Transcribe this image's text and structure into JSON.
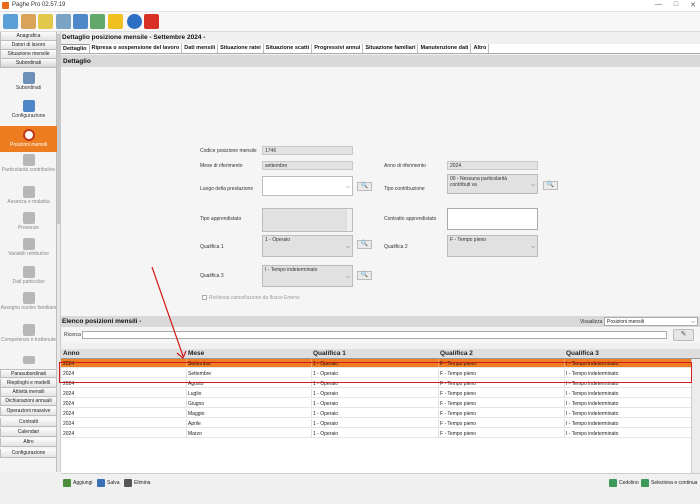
{
  "app": {
    "title": "Paghe Pro 02.57.19"
  },
  "colors": {
    "accent": "#ed7d20",
    "annotation": "#d11c1c"
  },
  "toolbar": {
    "icons": [
      "home-icon",
      "people-icon",
      "coins-icon",
      "gears-icon",
      "computer-icon",
      "lightning-icon",
      "info-icon",
      "close-icon"
    ]
  },
  "sidebar": {
    "top_buttons": [
      "Anagrafica",
      "Datori di lavoro",
      "Situazione mensile",
      "Subordinati"
    ],
    "items": [
      "Subordinati",
      "Configurazione",
      "Posizioni mensili",
      "Particolarità contributive",
      "Assenza e malattia",
      "Presenze",
      "Variabili retributive",
      "Dati particolari",
      "Assegno nucleo familiare",
      "Competenze e trattenute"
    ],
    "bottom_buttons": [
      "Parasubordinati",
      "Riepiloghi e modelli",
      "Attività mensili",
      "Dichiarazioni annuali",
      "Operazioni massive",
      "Contratti",
      "Calendari",
      "Altro",
      "Configurazione"
    ]
  },
  "detail": {
    "title": "Dettaglio posizione mensile - Settembre 2024 -",
    "tabs": [
      "Dettaglio",
      "Ripresa o sospensione del lavoro",
      "Dati mensili",
      "Situazione ratei",
      "Situazione scatti",
      "Progressivi annui",
      "Situazione familiari",
      "Manutenzione dati",
      "Altro"
    ],
    "section": "Dettaglio",
    "fields": {
      "codice_label": "Codice posizione mensile",
      "codice_value": "1746",
      "mese_label": "Mese di riferimento",
      "mese_value": "settembre",
      "anno_label": "Anno di riferimento",
      "anno_value": "2024",
      "luogo_label": "Luogo della prestazione",
      "luogo_value": "",
      "tipo_contr_label": "Tipo contribuzione",
      "tipo_contr_value": "00 - Nessuna particolarità contributi va",
      "tipo_appr_label": "Tipo apprendistato",
      "tipo_appr_value": "",
      "contratto_appr_label": "Contratto apprendistato",
      "contratto_appr_value": "",
      "qual1_label": "Qualifica 1",
      "qual1_value": "1 - Operaio",
      "qual2_label": "Qualifica 2",
      "qual2_value": "F - Tempo pieno",
      "qual3_label": "Qualifica 3",
      "qual3_value": "I - Tempo indeterminato",
      "flusso_label": "Richiesta cancellazione da flusso Emens"
    }
  },
  "list": {
    "title": "Elenco posizioni mensili -",
    "visualizza_label": "Visualizza",
    "visualizza_value": "Posizioni mensili",
    "ricerca_label": "Ricerca",
    "columns": [
      "Anno",
      "Mese",
      "Qualifica 1",
      "Qualifica 2",
      "Qualifica 3"
    ],
    "rows": [
      [
        "2024",
        "Settembre",
        "1 - Operaio",
        "F - Tempo pieno",
        "I - Tempo indeterminato"
      ],
      [
        "2024",
        "Settembre",
        "1 - Operaio",
        "F - Tempo pieno",
        "I - Tempo indeterminato"
      ],
      [
        "2024",
        "Agosto",
        "1 - Operaio",
        "F - Tempo pieno",
        "I - Tempo indeterminato"
      ],
      [
        "2024",
        "Luglio",
        "1 - Operaio",
        "F - Tempo pieno",
        "I - Tempo indeterminato"
      ],
      [
        "2024",
        "Giugno",
        "1 - Operaio",
        "F - Tempo pieno",
        "I - Tempo indeterminato"
      ],
      [
        "2024",
        "Maggio",
        "1 - Operaio",
        "F - Tempo pieno",
        "I - Tempo indeterminato"
      ],
      [
        "2024",
        "Aprile",
        "1 - Operaio",
        "F - Tempo pieno",
        "I - Tempo indeterminato"
      ],
      [
        "2024",
        "Marzo",
        "1 - Operaio",
        "F - Tempo pieno",
        "I - Tempo indeterminato"
      ]
    ]
  },
  "bottom": {
    "aggiungi": "Aggiungi",
    "salva": "Salva",
    "elimina": "Elimina",
    "cedolino": "Cedolino",
    "seleziona": "Seleziona e continua"
  }
}
